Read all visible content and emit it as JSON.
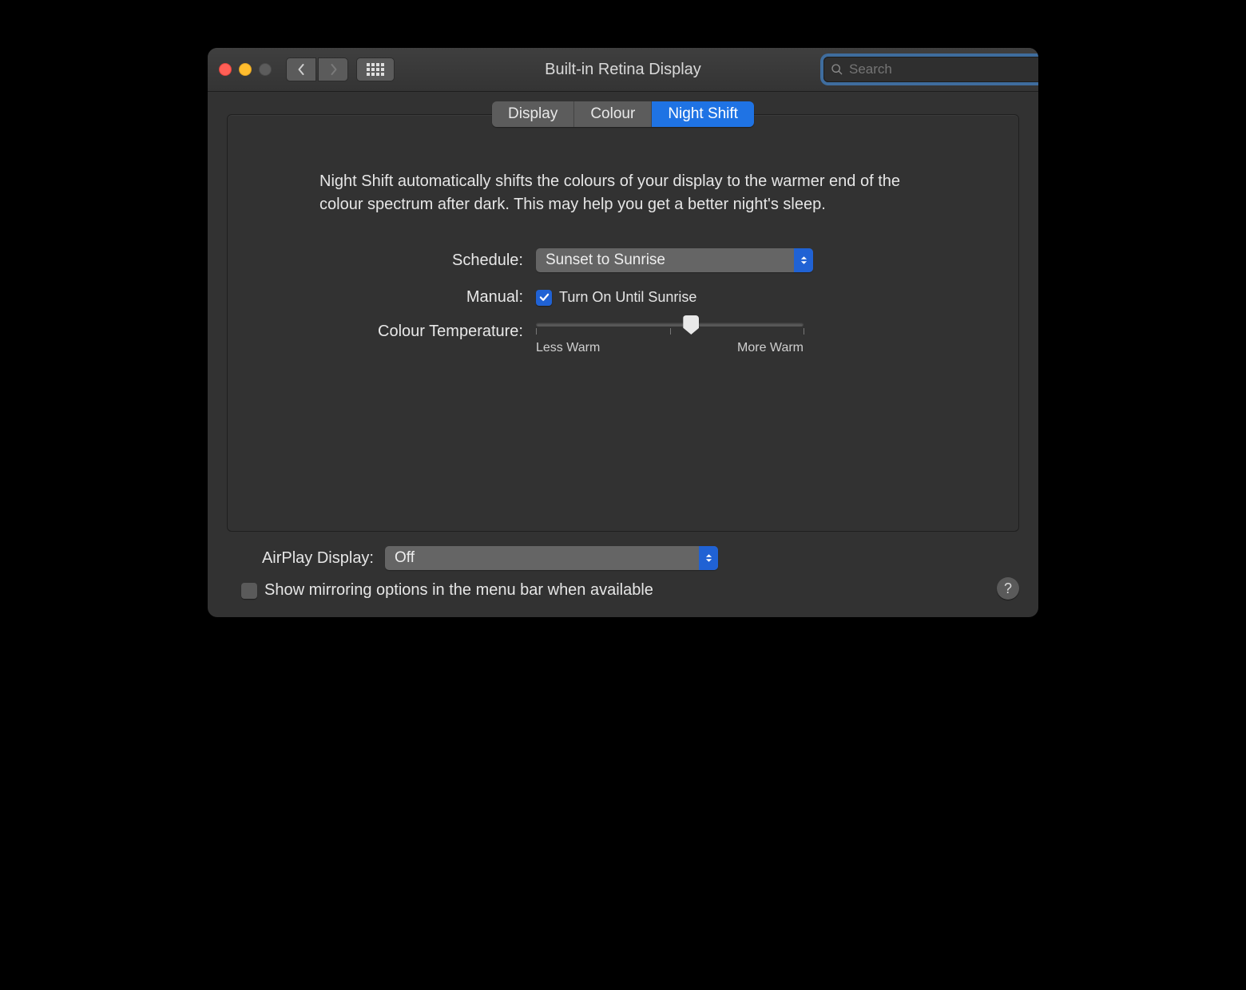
{
  "window": {
    "title": "Built-in Retina Display",
    "search_placeholder": "Search"
  },
  "tabs": {
    "display": "Display",
    "colour": "Colour",
    "night_shift": "Night Shift"
  },
  "nightshift": {
    "description": "Night Shift automatically shifts the colours of your display to the warmer end of the colour spectrum after dark. This may help you get a better night's sleep.",
    "schedule_label": "Schedule:",
    "schedule_value": "Sunset to Sunrise",
    "manual_label": "Manual:",
    "manual_checkbox_label": "Turn On Until Sunrise",
    "temperature_label": "Colour Temperature:",
    "temperature_min_label": "Less Warm",
    "temperature_max_label": "More Warm"
  },
  "airplay": {
    "label": "AirPlay Display:",
    "value": "Off"
  },
  "mirroring": {
    "label": "Show mirroring options in the menu bar when available"
  },
  "help_label": "?"
}
